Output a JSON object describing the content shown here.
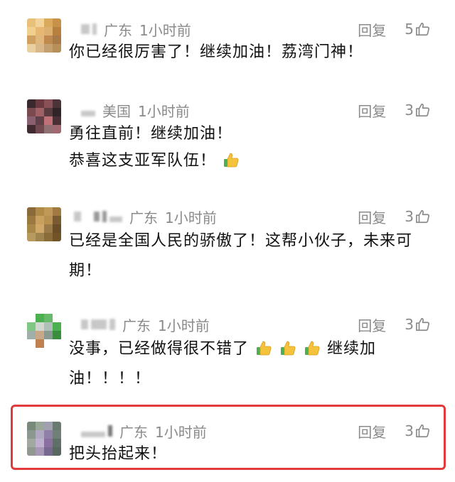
{
  "comments": [
    {
      "location": "广东",
      "time": "1小时前",
      "reply_label": "回复",
      "likes": "5",
      "lines": [
        "你已经很厉害了！继续加油！荔湾门神！"
      ],
      "avatar_colors": [
        "#e8c07a",
        "#f2d39a",
        "#d9a95c",
        "#c8914a",
        "#f0cf8f",
        "#e6b873",
        "#dbb070",
        "#b8803e",
        "#cfa060",
        "#e0b77c",
        "#c08a4e",
        "#a87a48",
        "#e8d0a0",
        "#d8b888",
        "#c4a070",
        "#b69058"
      ]
    },
    {
      "location": "美国",
      "time": "1小时前",
      "reply_label": "回复",
      "likes": "3",
      "lines": [
        "勇往直前！继续加油！",
        "恭喜这支亚军队伍！"
      ],
      "trailing_emoji_line": 1,
      "avatar_colors": [
        "#3a2a30",
        "#6a3a40",
        "#8a5058",
        "#4a3438",
        "#7a4a50",
        "#a06068",
        "#5a3c40",
        "#302428",
        "#8a6070",
        "#604048",
        "#c07078",
        "#4a3034",
        "#402c30",
        "#704a50",
        "#907070",
        "#a06870"
      ]
    },
    {
      "location": "广东",
      "time": "1小时前",
      "reply_label": "回复",
      "likes": "3",
      "lines": [
        "已经是全国人民的骄傲了！这帮小伙子，未来可",
        "期！"
      ],
      "avatar_colors": [
        "#8a6a3a",
        "#b08a48",
        "#c09858",
        "#a07a40",
        "#9a7840",
        "#c8a060",
        "#b89050",
        "#7a5a30",
        "#a88848",
        "#d0a868",
        "#9a7a48",
        "#6a4e28",
        "#b89a60",
        "#a08450",
        "#8a6c3a",
        "#705428"
      ]
    },
    {
      "location": "广东",
      "time": "1小时前",
      "reply_label": "回复",
      "likes": "3",
      "lines": [
        "没事，已经做得很不错了",
        "油！！！！"
      ],
      "inline_emoji_after": "继续加",
      "avatar_colors": [
        "#ffffff",
        "#4caf50",
        "#66bb6a",
        "#ffffff",
        "#81c784",
        "#d0d8d0",
        "#b0c0b8",
        "#4caf50",
        "#a0b0a8",
        "#c8a888",
        "#8a9a90",
        "#388e3c",
        "#ffffff",
        "#c08050",
        "#ffffff",
        "#ffffff"
      ]
    },
    {
      "location": "广东",
      "time": "1小时前",
      "reply_label": "回复",
      "likes": "3",
      "lines": [
        "把头抬起来！"
      ],
      "avatar_colors": [
        "#7a8a7a",
        "#9aa89a",
        "#a0a0b0",
        "#6a7a70",
        "#8a9890",
        "#b0a8c0",
        "#9080a8",
        "#708078",
        "#a0a8a0",
        "#c0b0d0",
        "#8a70a0",
        "#607068",
        "#909890",
        "#a898b8",
        "#786890",
        "#586860"
      ]
    }
  ],
  "colors": {
    "meta_gray": "#8a8a8a",
    "text": "#111111",
    "highlight": "#e23a3a",
    "thumb_yellow": "#f5c23c",
    "thumb_green": "#4caf50"
  },
  "icons": {
    "like": "thumbs-up-outline-icon",
    "emoji": "thumbs-up-emoji-icon"
  }
}
